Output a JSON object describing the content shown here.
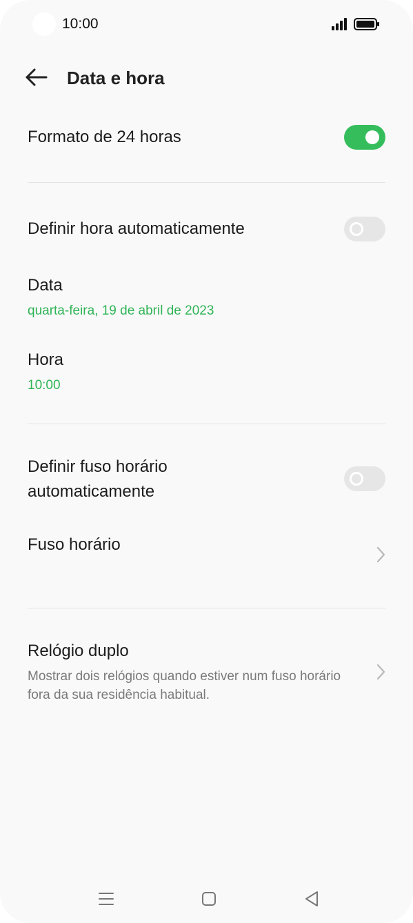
{
  "status_bar": {
    "time": "10:00",
    "signal_icon": "signal-bars-icon",
    "battery_icon": "battery-full-icon"
  },
  "header": {
    "back_icon": "arrow-left-icon",
    "title": "Data e hora"
  },
  "settings": {
    "format_24h": {
      "label": "Formato de 24 horas",
      "enabled": true
    },
    "auto_time": {
      "label": "Definir hora automaticamente",
      "enabled": false
    },
    "date": {
      "label": "Data",
      "value": "quarta-feira, 19 de abril de 2023"
    },
    "hour": {
      "label": "Hora",
      "value": "10:00"
    },
    "auto_timezone": {
      "label_line1": "Definir fuso horário",
      "label_line2": "automaticamente",
      "enabled": false
    },
    "timezone": {
      "label": "Fuso horário",
      "icon": "chevron-right-icon"
    },
    "dual_clock": {
      "label": "Relógio duplo",
      "description_line1": "Mostrar dois relógios quando estiver num fuso horário",
      "description_line2": "fora da sua residência habitual.",
      "icon": "chevron-right-icon"
    }
  },
  "colors": {
    "accent": "#35bd5c",
    "accent_text": "#2fb455",
    "background": "#f9f9f9",
    "switch_off": "#e6e6e6"
  },
  "nav_bar": {
    "menu_icon": "menu-lines-icon",
    "home_icon": "home-square-icon",
    "back_icon": "back-triangle-icon"
  }
}
